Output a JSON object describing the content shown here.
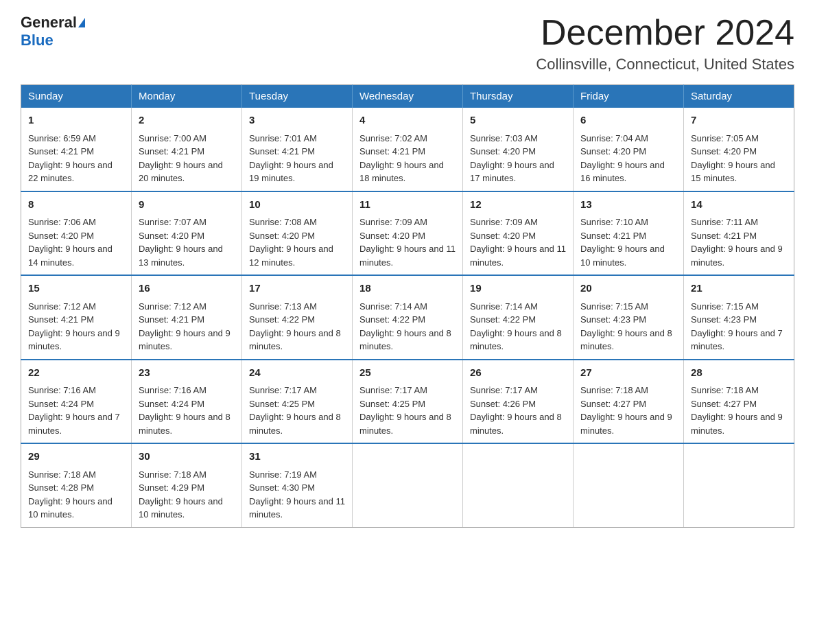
{
  "logo": {
    "general": "General",
    "blue": "Blue"
  },
  "header": {
    "month": "December 2024",
    "location": "Collinsville, Connecticut, United States"
  },
  "weekdays": [
    "Sunday",
    "Monday",
    "Tuesday",
    "Wednesday",
    "Thursday",
    "Friday",
    "Saturday"
  ],
  "weeks": [
    [
      {
        "day": "1",
        "sunrise": "6:59 AM",
        "sunset": "4:21 PM",
        "daylight": "9 hours and 22 minutes."
      },
      {
        "day": "2",
        "sunrise": "7:00 AM",
        "sunset": "4:21 PM",
        "daylight": "9 hours and 20 minutes."
      },
      {
        "day": "3",
        "sunrise": "7:01 AM",
        "sunset": "4:21 PM",
        "daylight": "9 hours and 19 minutes."
      },
      {
        "day": "4",
        "sunrise": "7:02 AM",
        "sunset": "4:21 PM",
        "daylight": "9 hours and 18 minutes."
      },
      {
        "day": "5",
        "sunrise": "7:03 AM",
        "sunset": "4:20 PM",
        "daylight": "9 hours and 17 minutes."
      },
      {
        "day": "6",
        "sunrise": "7:04 AM",
        "sunset": "4:20 PM",
        "daylight": "9 hours and 16 minutes."
      },
      {
        "day": "7",
        "sunrise": "7:05 AM",
        "sunset": "4:20 PM",
        "daylight": "9 hours and 15 minutes."
      }
    ],
    [
      {
        "day": "8",
        "sunrise": "7:06 AM",
        "sunset": "4:20 PM",
        "daylight": "9 hours and 14 minutes."
      },
      {
        "day": "9",
        "sunrise": "7:07 AM",
        "sunset": "4:20 PM",
        "daylight": "9 hours and 13 minutes."
      },
      {
        "day": "10",
        "sunrise": "7:08 AM",
        "sunset": "4:20 PM",
        "daylight": "9 hours and 12 minutes."
      },
      {
        "day": "11",
        "sunrise": "7:09 AM",
        "sunset": "4:20 PM",
        "daylight": "9 hours and 11 minutes."
      },
      {
        "day": "12",
        "sunrise": "7:09 AM",
        "sunset": "4:20 PM",
        "daylight": "9 hours and 11 minutes."
      },
      {
        "day": "13",
        "sunrise": "7:10 AM",
        "sunset": "4:21 PM",
        "daylight": "9 hours and 10 minutes."
      },
      {
        "day": "14",
        "sunrise": "7:11 AM",
        "sunset": "4:21 PM",
        "daylight": "9 hours and 9 minutes."
      }
    ],
    [
      {
        "day": "15",
        "sunrise": "7:12 AM",
        "sunset": "4:21 PM",
        "daylight": "9 hours and 9 minutes."
      },
      {
        "day": "16",
        "sunrise": "7:12 AM",
        "sunset": "4:21 PM",
        "daylight": "9 hours and 9 minutes."
      },
      {
        "day": "17",
        "sunrise": "7:13 AM",
        "sunset": "4:22 PM",
        "daylight": "9 hours and 8 minutes."
      },
      {
        "day": "18",
        "sunrise": "7:14 AM",
        "sunset": "4:22 PM",
        "daylight": "9 hours and 8 minutes."
      },
      {
        "day": "19",
        "sunrise": "7:14 AM",
        "sunset": "4:22 PM",
        "daylight": "9 hours and 8 minutes."
      },
      {
        "day": "20",
        "sunrise": "7:15 AM",
        "sunset": "4:23 PM",
        "daylight": "9 hours and 8 minutes."
      },
      {
        "day": "21",
        "sunrise": "7:15 AM",
        "sunset": "4:23 PM",
        "daylight": "9 hours and 7 minutes."
      }
    ],
    [
      {
        "day": "22",
        "sunrise": "7:16 AM",
        "sunset": "4:24 PM",
        "daylight": "9 hours and 7 minutes."
      },
      {
        "day": "23",
        "sunrise": "7:16 AM",
        "sunset": "4:24 PM",
        "daylight": "9 hours and 8 minutes."
      },
      {
        "day": "24",
        "sunrise": "7:17 AM",
        "sunset": "4:25 PM",
        "daylight": "9 hours and 8 minutes."
      },
      {
        "day": "25",
        "sunrise": "7:17 AM",
        "sunset": "4:25 PM",
        "daylight": "9 hours and 8 minutes."
      },
      {
        "day": "26",
        "sunrise": "7:17 AM",
        "sunset": "4:26 PM",
        "daylight": "9 hours and 8 minutes."
      },
      {
        "day": "27",
        "sunrise": "7:18 AM",
        "sunset": "4:27 PM",
        "daylight": "9 hours and 9 minutes."
      },
      {
        "day": "28",
        "sunrise": "7:18 AM",
        "sunset": "4:27 PM",
        "daylight": "9 hours and 9 minutes."
      }
    ],
    [
      {
        "day": "29",
        "sunrise": "7:18 AM",
        "sunset": "4:28 PM",
        "daylight": "9 hours and 10 minutes."
      },
      {
        "day": "30",
        "sunrise": "7:18 AM",
        "sunset": "4:29 PM",
        "daylight": "9 hours and 10 minutes."
      },
      {
        "day": "31",
        "sunrise": "7:19 AM",
        "sunset": "4:30 PM",
        "daylight": "9 hours and 11 minutes."
      },
      null,
      null,
      null,
      null
    ]
  ]
}
